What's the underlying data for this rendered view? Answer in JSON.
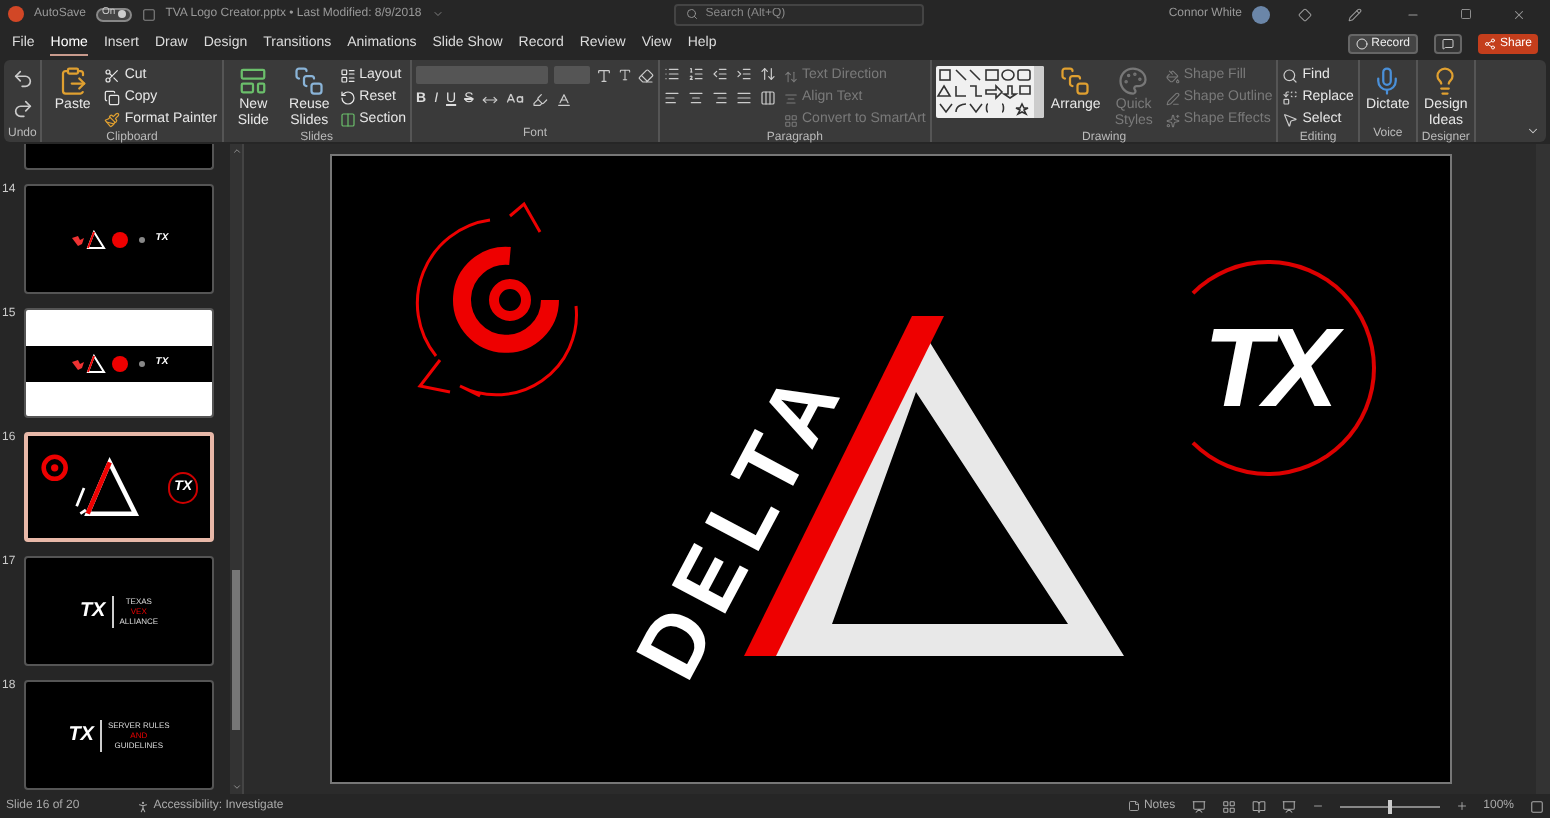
{
  "title_bar": {
    "autosave_label": "AutoSave",
    "autosave_on": true,
    "autosave_state": "On",
    "file_title": "TVA Logo Creator.pptx • Last Modified: 8/9/2018",
    "search_placeholder": "Search (Alt+Q)",
    "user_name": "Connor White"
  },
  "menu_tabs": [
    {
      "label": "File",
      "selected": false
    },
    {
      "label": "Home",
      "selected": true
    },
    {
      "label": "Insert",
      "selected": false
    },
    {
      "label": "Draw",
      "selected": false
    },
    {
      "label": "Design",
      "selected": false
    },
    {
      "label": "Transitions",
      "selected": false
    },
    {
      "label": "Animations",
      "selected": false
    },
    {
      "label": "Slide Show",
      "selected": false
    },
    {
      "label": "Record",
      "selected": false
    },
    {
      "label": "Review",
      "selected": false
    },
    {
      "label": "View",
      "selected": false
    },
    {
      "label": "Help",
      "selected": false
    }
  ],
  "actions": {
    "record": "Record",
    "share": "Share"
  },
  "ribbon": {
    "groups": [
      {
        "kind": "undo",
        "label": "Undo"
      },
      {
        "kind": "clipboard",
        "label": "Clipboard",
        "big": [
          {
            "label": "Paste",
            "disabled": false
          }
        ],
        "items": [
          {
            "label": "Cut",
            "disabled": false
          },
          {
            "label": "Copy",
            "disabled": false
          },
          {
            "label": "Format Painter",
            "disabled": false
          }
        ]
      },
      {
        "kind": "slides",
        "label": "Slides",
        "big": [
          {
            "label": "New Slide",
            "disabled": false
          },
          {
            "label": "Reuse Slides",
            "disabled": false
          }
        ],
        "items": [
          {
            "label": "Layout",
            "disabled": false
          },
          {
            "label": "Reset",
            "disabled": false
          },
          {
            "label": "Section",
            "disabled": false
          }
        ]
      },
      {
        "kind": "font",
        "label": "Font",
        "format_buttons": [
          "B",
          "I",
          "U",
          "S"
        ]
      },
      {
        "kind": "paragraph",
        "label": "Paragraph",
        "items": [
          {
            "label": "Text Direction",
            "disabled": true
          },
          {
            "label": "Align Text",
            "disabled": true
          },
          {
            "label": "Convert to SmartArt",
            "disabled": true
          }
        ]
      },
      {
        "kind": "drawing",
        "label": "Drawing",
        "big": [
          {
            "label": "Arrange",
            "disabled": false
          },
          {
            "label": "Quick Styles",
            "disabled": true
          }
        ],
        "items": [
          {
            "label": "Shape Fill",
            "disabled": true
          },
          {
            "label": "Shape Outline",
            "disabled": true
          },
          {
            "label": "Shape Effects",
            "disabled": true
          }
        ]
      },
      {
        "kind": "editing",
        "label": "Editing",
        "items": [
          {
            "label": "Find",
            "disabled": false
          },
          {
            "label": "Replace",
            "disabled": false
          },
          {
            "label": "Select",
            "disabled": false
          }
        ]
      },
      {
        "kind": "voice",
        "label": "Voice",
        "big": [
          {
            "label": "Dictate",
            "disabled": false
          }
        ]
      },
      {
        "kind": "designer",
        "label": "Designer",
        "big": [
          {
            "label": "Design Ideas",
            "disabled": false
          }
        ]
      }
    ]
  },
  "slides": [
    {
      "kind": "blank",
      "selected": false
    },
    {
      "number": "14",
      "kind": "logos",
      "selected": false,
      "logo_text": "TX"
    },
    {
      "number": "15",
      "kind": "banner",
      "selected": false,
      "logo_text": "TX"
    },
    {
      "number": "16",
      "kind": "delta",
      "selected": true,
      "logo_text": "TX"
    },
    {
      "number": "17",
      "kind": "title",
      "selected": false,
      "logo_text": "TX",
      "lines": [
        "TEXAS",
        "VEX",
        "ALLIANCE"
      ]
    },
    {
      "number": "18",
      "kind": "title",
      "selected": false,
      "logo_text": "TX",
      "lines": [
        "SERVER RULES",
        "AND",
        "GUIDELINES"
      ]
    }
  ],
  "main_slide": {
    "delta_text": "DELTA",
    "logo_text": "TX"
  },
  "status_bar": {
    "slide_position": "Slide 16 of 20",
    "accessibility": "Accessibility: Investigate",
    "notes": "Notes",
    "zoom": {
      "level": 0.5
    },
    "zoom_text": "100%"
  }
}
